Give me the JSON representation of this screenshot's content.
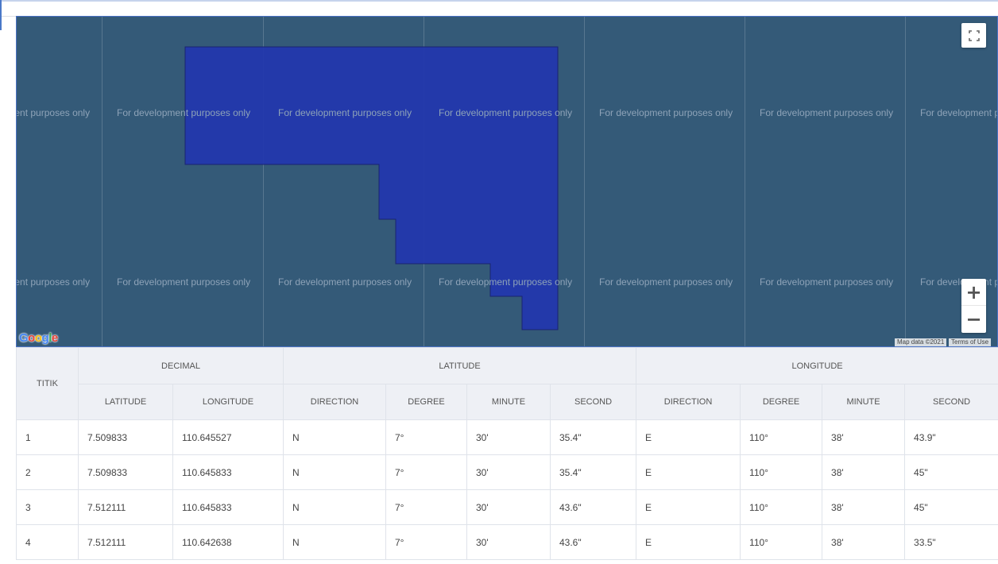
{
  "map": {
    "watermark_text": "For development purposes only",
    "polygon_fill": "#2338ad",
    "water_color": "#345a78",
    "fullscreen_icon": "fullscreen-icon",
    "zoom_in_label": "+",
    "zoom_out_label": "−",
    "logo_letters": [
      "G",
      "o",
      "o",
      "g",
      "l",
      "e"
    ],
    "attribution": "Map data ©2021",
    "terms_label": "Terms of Use"
  },
  "table": {
    "titik_header": "TITIK",
    "group_headers": [
      "DECIMAL",
      "LATITUDE",
      "LONGITUDE"
    ],
    "sub_headers": [
      "LATITUDE",
      "LONGITUDE",
      "DIRECTION",
      "DEGREE",
      "MINUTE",
      "SECOND",
      "DIRECTION",
      "DEGREE",
      "MINUTE",
      "SECOND"
    ],
    "rows": [
      [
        "1",
        "7.509833",
        "110.645527",
        "N",
        "7°",
        "30'",
        "35.4\"",
        "E",
        "110°",
        "38'",
        "43.9\""
      ],
      [
        "2",
        "7.509833",
        "110.645833",
        "N",
        "7°",
        "30'",
        "35.4\"",
        "E",
        "110°",
        "38'",
        "45\""
      ],
      [
        "3",
        "7.512111",
        "110.645833",
        "N",
        "7°",
        "30'",
        "43.6\"",
        "E",
        "110°",
        "38'",
        "45\""
      ],
      [
        "4",
        "7.512111",
        "110.642638",
        "N",
        "7°",
        "30'",
        "43.6\"",
        "E",
        "110°",
        "38'",
        "33.5\""
      ]
    ]
  }
}
